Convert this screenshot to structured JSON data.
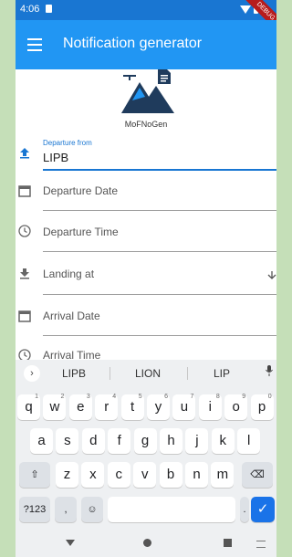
{
  "status_bar": {
    "time": "4:06",
    "debug_banner": "DEBUG"
  },
  "app_bar": {
    "title": "Notification generator"
  },
  "logo": {
    "label": "MoFNoGen"
  },
  "form": {
    "departure": {
      "label": "Departure from",
      "value": "LIPB"
    },
    "departure_date": {
      "placeholder": "Departure Date"
    },
    "departure_time": {
      "placeholder": "Departure Time"
    },
    "landing_at": {
      "placeholder": "Landing at"
    },
    "arrival_date": {
      "placeholder": "Arrival Date"
    },
    "arrival_time": {
      "placeholder": "Arrival Time"
    }
  },
  "keyboard": {
    "suggestions": [
      "LIPB",
      "LION",
      "LIP"
    ],
    "row1": [
      {
        "key": "q",
        "hint": "1"
      },
      {
        "key": "w",
        "hint": "2"
      },
      {
        "key": "e",
        "hint": "3"
      },
      {
        "key": "r",
        "hint": "4"
      },
      {
        "key": "t",
        "hint": "5"
      },
      {
        "key": "y",
        "hint": "6"
      },
      {
        "key": "u",
        "hint": "7"
      },
      {
        "key": "i",
        "hint": "8"
      },
      {
        "key": "o",
        "hint": "9"
      },
      {
        "key": "p",
        "hint": "0"
      }
    ],
    "row2": [
      "a",
      "s",
      "d",
      "f",
      "g",
      "h",
      "j",
      "k",
      "l"
    ],
    "row3": [
      "z",
      "x",
      "c",
      "v",
      "b",
      "n",
      "m"
    ],
    "symbols_key": "?123",
    "comma_key": ",",
    "period_key": ".",
    "emoji_key": "☺",
    "shift_key": "⇧",
    "backspace_key": "⌫",
    "enter_key": "✓",
    "expand_key": "›"
  },
  "colors": {
    "app_bar": "#2196f3",
    "status_bar": "#1976d2",
    "accent": "#1976d2",
    "keyboard_enter": "#1a73e8"
  }
}
